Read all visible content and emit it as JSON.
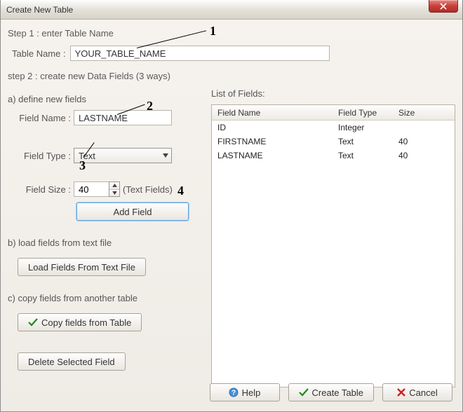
{
  "window": {
    "title": "Create New Table"
  },
  "step1": {
    "heading": "Step 1 : enter Table Name",
    "label": "Table Name :",
    "value": "YOUR_TABLE_NAME"
  },
  "step2": {
    "heading": "step 2 : create new Data Fields (3 ways)",
    "a_heading": "a) define new fields",
    "field_name_label": "Field Name :",
    "field_name_value": "LASTNAME",
    "field_type_label": "Field Type :",
    "field_type_value": "Text",
    "field_size_label": "Field Size :",
    "field_size_value": "40",
    "field_size_hint": "(Text Fields)",
    "add_field_button": "Add Field",
    "b_heading": "b) load fields from text file",
    "load_button": "Load Fields From Text File",
    "c_heading": "c) copy fields from another table",
    "copy_button": "Copy fields from Table",
    "delete_button": "Delete Selected Field"
  },
  "list": {
    "title": "List of Fields:",
    "col_name": "Field Name",
    "col_type": "Field Type",
    "col_size": "Size",
    "rows": [
      {
        "name": "ID",
        "type": "Integer",
        "size": ""
      },
      {
        "name": "FIRSTNAME",
        "type": "Text",
        "size": "40"
      },
      {
        "name": "LASTNAME",
        "type": "Text",
        "size": "40"
      }
    ]
  },
  "footer": {
    "help": "Help",
    "create": "Create Table",
    "cancel": "Cancel"
  },
  "annotations": {
    "n1": "1",
    "n2": "2",
    "n3": "3",
    "n4": "4"
  }
}
